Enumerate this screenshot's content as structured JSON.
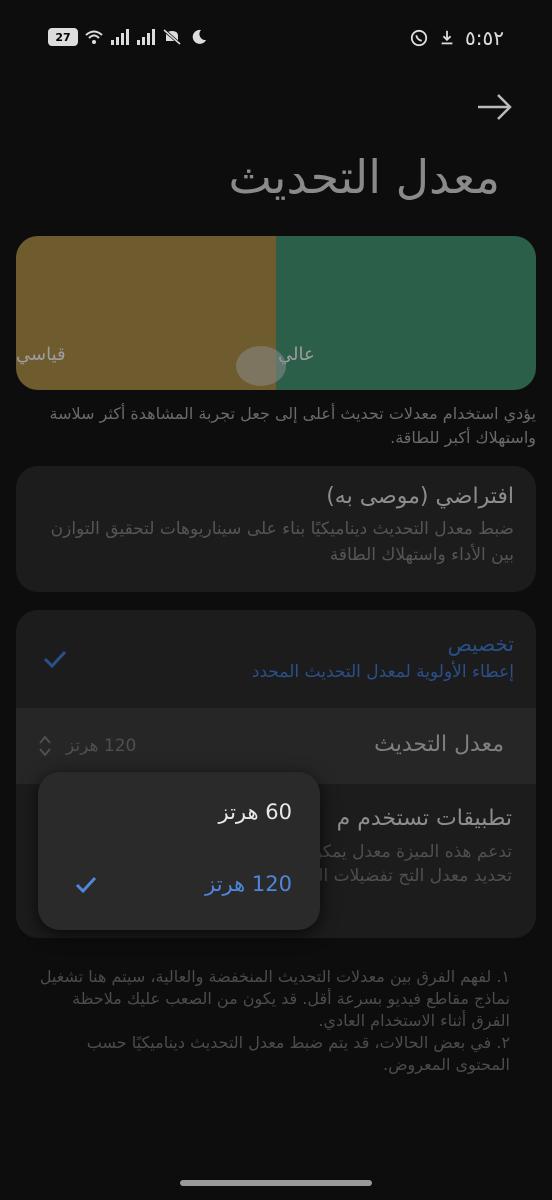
{
  "status_bar": {
    "time": "٥:٥٢",
    "battery": "27"
  },
  "page": {
    "title": "معدل التحديث"
  },
  "preview": {
    "label_standard": "قياسي",
    "label_high": "عالي",
    "description": "يؤدي استخدام معدلات تحديث أعلى إلى جعل تجربة المشاهدة أكثر سلاسة واستهلاك أكبر للطاقة."
  },
  "default_option": {
    "title": "افتراضي (موصى به)",
    "description": "ضبط معدل التحديث ديناميكيًا بناء على سيناريوهات لتحقيق التوازن بين الأداء واستهلاك الطاقة"
  },
  "custom_option": {
    "title": "تخصيص",
    "description": "إعطاء الأولوية لمعدل التحديث المحدد",
    "selected": true
  },
  "refresh_rate_row": {
    "title": "معدل التحديث",
    "value": "120 هرتز"
  },
  "apps_row": {
    "title": "تطبيقات تستخدم م",
    "description": "تدعم هذه الميزة معدل يمكن تحديد معدل التح تفضيلات الجهاز."
  },
  "dropdown": {
    "options": [
      {
        "label": "60 هرتز",
        "selected": false
      },
      {
        "label": "120 هرتز",
        "selected": true
      }
    ]
  },
  "footnotes": {
    "note1": "١. لفهم الفرق بين معدلات التحديث المنخفضة والعالية، سيتم هنا تشغيل نماذج مقاطع فيديو بسرعة أقل. قد يكون من الصعب عليك ملاحظة الفرق أثناء الاستخدام العادي.",
    "note2": "٢. في بعض الحالات، قد يتم ضبط معدل التحديث ديناميكيًا حسب المحتوى المعروض."
  },
  "colors": {
    "accent": "#4f86dc",
    "preview_standard": "#6e5b2e",
    "preview_high": "#2c5f4a"
  },
  "icons": [
    "battery-icon",
    "wifi-icon",
    "signal-icon",
    "mute-icon",
    "moon-icon",
    "whatsapp-icon",
    "download-icon",
    "back-arrow-icon",
    "check-icon",
    "up-down-icon"
  ]
}
